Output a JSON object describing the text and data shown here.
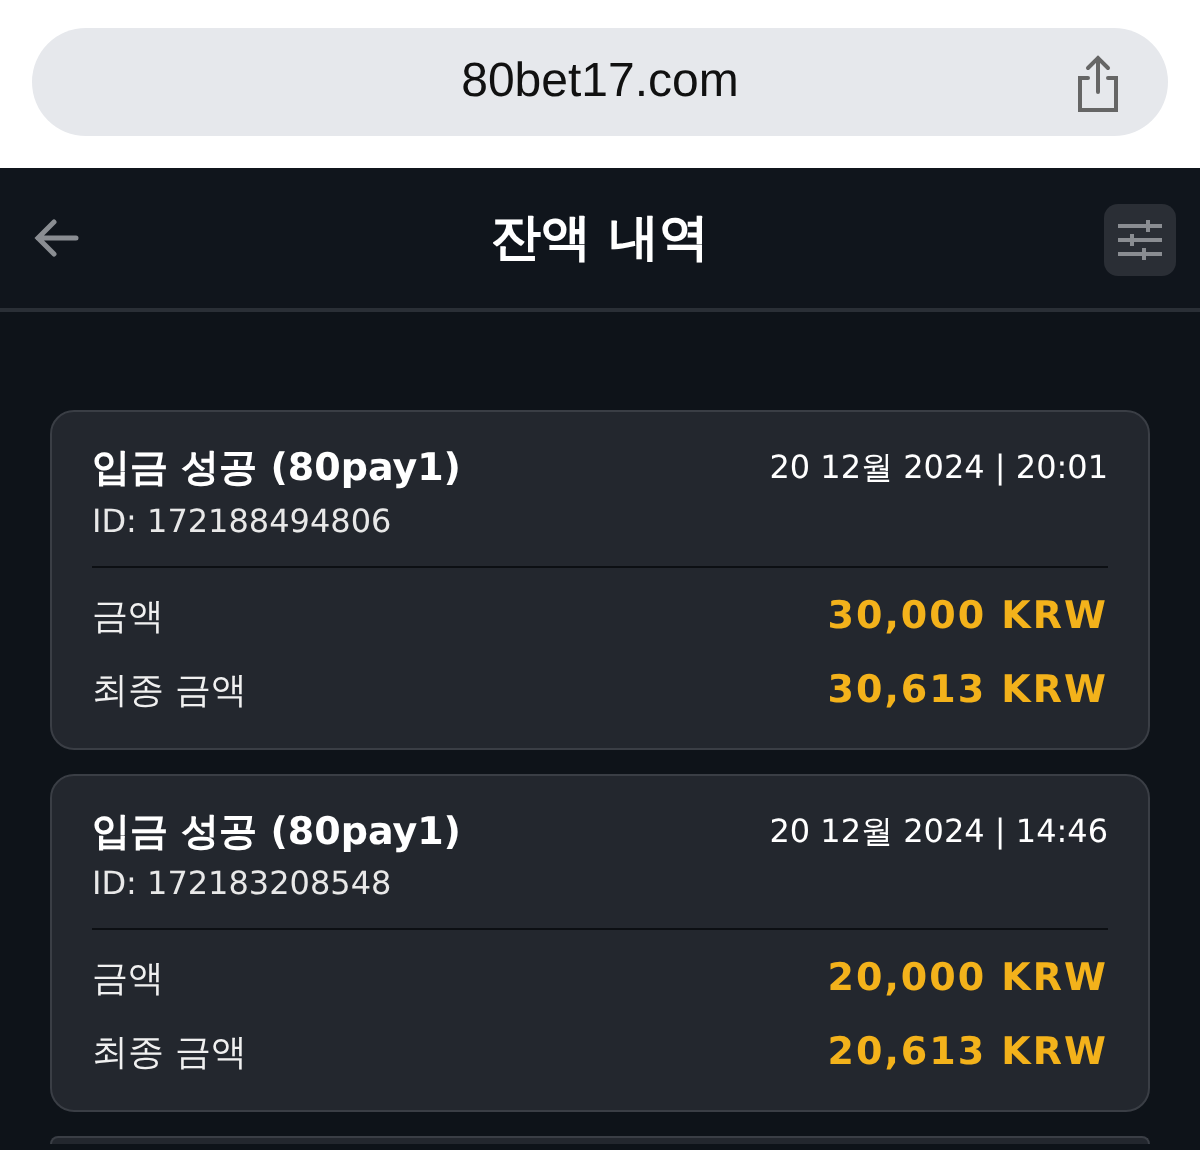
{
  "browser": {
    "address": "80bet17.com"
  },
  "header": {
    "title": "잔액 내역"
  },
  "transactions": [
    {
      "title": "입금 성공 (80pay1)",
      "datetime": "20 12월 2024 | 20:01",
      "id": "ID: 172188494806",
      "rows": [
        {
          "label": "금액",
          "value": "30,000 KRW"
        },
        {
          "label": "최종 금액",
          "value": "30,613 KRW"
        }
      ]
    },
    {
      "title": "입금 성공 (80pay1)",
      "datetime": "20 12월 2024 | 14:46",
      "id": "ID: 172183208548",
      "rows": [
        {
          "label": "금액",
          "value": "20,000 KRW"
        },
        {
          "label": "최종 금액",
          "value": "20,613 KRW"
        }
      ]
    }
  ]
}
